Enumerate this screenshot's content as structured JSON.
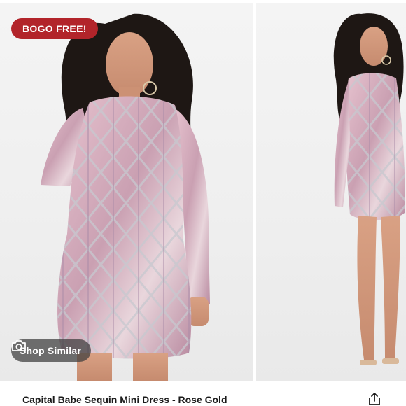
{
  "gallery": {
    "badge": "BOGO FREE!",
    "shop_similar_label": "Shop Similar",
    "images": [
      {
        "icon": "product-photo-front"
      },
      {
        "icon": "product-photo-full-length"
      }
    ]
  },
  "product": {
    "title": "Capital Babe Sequin Mini Dress - Rose Gold"
  },
  "icons": {
    "camera": "camera-icon",
    "share": "share-icon"
  },
  "colors": {
    "badge_bg": "#b2242a",
    "overlay_button_bg": "#3c3c3c",
    "dress": "#d8a9b8"
  }
}
